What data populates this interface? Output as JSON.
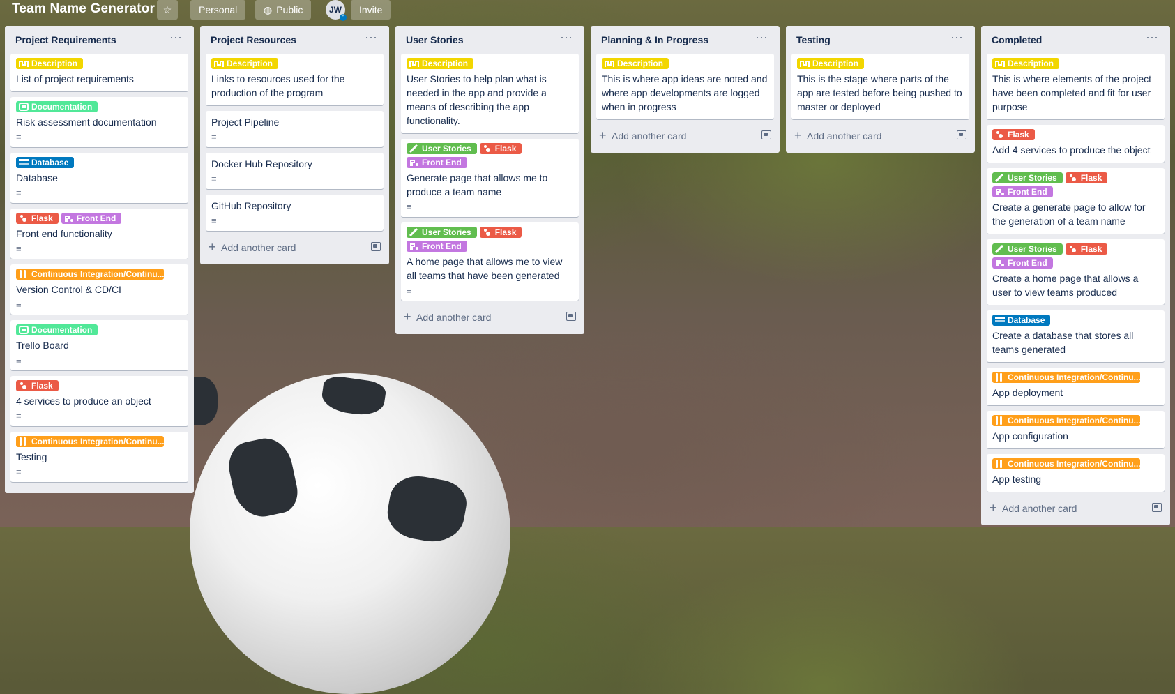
{
  "header": {
    "title": "Team Name Generator",
    "visibility_team": "Personal",
    "visibility": "Public",
    "avatar_initials": "JW",
    "invite": "Invite"
  },
  "colors": {
    "yellow": "#f2d600",
    "green": "#61bd4f",
    "mint": "#51e898",
    "blue": "#0079bf",
    "red": "#eb5a46",
    "purple": "#c377e0",
    "orange": "#ff9f1a"
  },
  "lists": [
    {
      "title": "Project Requirements",
      "cards": [
        {
          "labels": [
            {
              "text": "Description",
              "color": "#f2d600",
              "icon": "pipeline-icon"
            }
          ],
          "title": "List of project requirements",
          "desc": false
        },
        {
          "labels": [
            {
              "text": "Documentation",
              "color": "#51e898",
              "icon": "document-icon"
            }
          ],
          "title": "Risk assessment documentation",
          "desc": true
        },
        {
          "labels": [
            {
              "text": "Database",
              "color": "#0079bf",
              "icon": "database-icon"
            }
          ],
          "title": "Database",
          "desc": true
        },
        {
          "labels": [
            {
              "text": "Flask",
              "color": "#eb5a46",
              "icon": "flask-icon"
            },
            {
              "text": "Front End",
              "color": "#c377e0",
              "icon": "frontend-icon"
            }
          ],
          "title": "Front end functionality",
          "desc": true
        },
        {
          "labels": [
            {
              "text": "Continuous Integration/Continu...",
              "color": "#ff9f1a",
              "icon": "ci-icon"
            }
          ],
          "title": "Version Control & CD/CI",
          "desc": true
        },
        {
          "labels": [
            {
              "text": "Documentation",
              "color": "#51e898",
              "icon": "document-icon"
            }
          ],
          "title": "Trello Board",
          "desc": true
        },
        {
          "labels": [
            {
              "text": "Flask",
              "color": "#eb5a46",
              "icon": "flask-icon"
            }
          ],
          "title": "4 services to produce an object",
          "desc": true
        },
        {
          "labels": [
            {
              "text": "Continuous Integration/Continu...",
              "color": "#ff9f1a",
              "icon": "ci-icon"
            }
          ],
          "title": "Testing",
          "desc": true
        }
      ],
      "add": null
    },
    {
      "title": "Project Resources",
      "cards": [
        {
          "labels": [
            {
              "text": "Description",
              "color": "#f2d600",
              "icon": "pipeline-icon"
            }
          ],
          "title": "Links to resources used for the production of the program",
          "desc": false
        },
        {
          "labels": [],
          "title": "Project Pipeline",
          "desc": true
        },
        {
          "labels": [],
          "title": "Docker Hub Repository",
          "desc": true
        },
        {
          "labels": [],
          "title": "GitHub Repository",
          "desc": true
        }
      ],
      "add": "Add another card"
    },
    {
      "title": "User Stories",
      "cards": [
        {
          "labels": [
            {
              "text": "Description",
              "color": "#f2d600",
              "icon": "pipeline-icon"
            }
          ],
          "title": "User Stories to help plan what is needed in the app and provide a means of describing the app functionality.",
          "desc": false
        },
        {
          "labels": [
            {
              "text": "User Stories",
              "color": "#61bd4f",
              "icon": "story-icon"
            },
            {
              "text": "Flask",
              "color": "#eb5a46",
              "icon": "flask-icon"
            },
            {
              "text": "Front End",
              "color": "#c377e0",
              "icon": "frontend-icon"
            }
          ],
          "title": "Generate page that allows me to produce a team name",
          "desc": true
        },
        {
          "labels": [
            {
              "text": "User Stories",
              "color": "#61bd4f",
              "icon": "story-icon"
            },
            {
              "text": "Flask",
              "color": "#eb5a46",
              "icon": "flask-icon"
            },
            {
              "text": "Front End",
              "color": "#c377e0",
              "icon": "frontend-icon"
            }
          ],
          "title": "A home page that allows me to view all teams that have been generated",
          "desc": true
        }
      ],
      "add": "Add another card"
    },
    {
      "title": "Planning & In Progress",
      "cards": [
        {
          "labels": [
            {
              "text": "Description",
              "color": "#f2d600",
              "icon": "pipeline-icon"
            }
          ],
          "title": "This is where app ideas are noted and where app developments are logged when in progress",
          "desc": false
        }
      ],
      "add": "Add another card"
    },
    {
      "title": "Testing",
      "cards": [
        {
          "labels": [
            {
              "text": "Description",
              "color": "#f2d600",
              "icon": "pipeline-icon"
            }
          ],
          "title": "This is the stage where parts of the app are tested before being pushed to master or deployed",
          "desc": false
        }
      ],
      "add": "Add another card"
    },
    {
      "title": "Completed",
      "cards": [
        {
          "labels": [
            {
              "text": "Description",
              "color": "#f2d600",
              "icon": "pipeline-icon"
            }
          ],
          "title": "This is where elements of the project have been completed and fit for user purpose",
          "desc": false
        },
        {
          "labels": [
            {
              "text": "Flask",
              "color": "#eb5a46",
              "icon": "flask-icon"
            }
          ],
          "title": "Add 4 services to produce the object",
          "desc": false
        },
        {
          "labels": [
            {
              "text": "User Stories",
              "color": "#61bd4f",
              "icon": "story-icon"
            },
            {
              "text": "Flask",
              "color": "#eb5a46",
              "icon": "flask-icon"
            },
            {
              "text": "Front End",
              "color": "#c377e0",
              "icon": "frontend-icon"
            }
          ],
          "title": "Create a generate page to allow for the generation of a team name",
          "desc": false
        },
        {
          "labels": [
            {
              "text": "User Stories",
              "color": "#61bd4f",
              "icon": "story-icon"
            },
            {
              "text": "Flask",
              "color": "#eb5a46",
              "icon": "flask-icon"
            },
            {
              "text": "Front End",
              "color": "#c377e0",
              "icon": "frontend-icon"
            }
          ],
          "title": "Create a home page that allows a user to view teams produced",
          "desc": false
        },
        {
          "labels": [
            {
              "text": "Database",
              "color": "#0079bf",
              "icon": "database-icon"
            }
          ],
          "title": "Create a database that stores all teams generated",
          "desc": false
        },
        {
          "labels": [
            {
              "text": "Continuous Integration/Continu...",
              "color": "#ff9f1a",
              "icon": "ci-icon"
            }
          ],
          "title": "App deployment",
          "desc": false
        },
        {
          "labels": [
            {
              "text": "Continuous Integration/Continu...",
              "color": "#ff9f1a",
              "icon": "ci-icon"
            }
          ],
          "title": "App configuration",
          "desc": false
        },
        {
          "labels": [
            {
              "text": "Continuous Integration/Continu...",
              "color": "#ff9f1a",
              "icon": "ci-icon"
            }
          ],
          "title": "App testing",
          "desc": false
        }
      ],
      "add": "Add another card"
    }
  ]
}
